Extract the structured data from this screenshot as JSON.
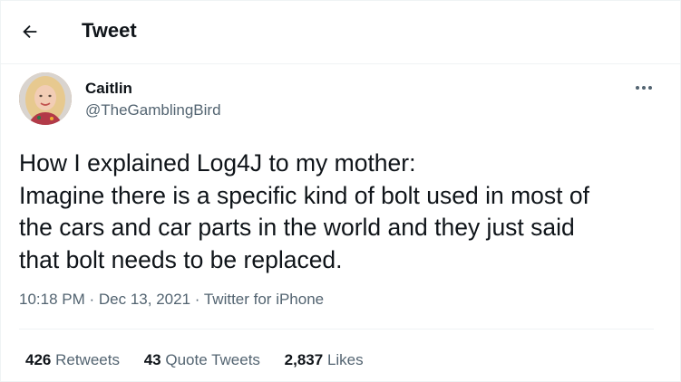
{
  "header": {
    "title": "Tweet",
    "back_icon": "arrow-left-icon"
  },
  "author": {
    "name": "Caitlin",
    "handle": "@TheGamblingBird"
  },
  "tweet": {
    "lines": [
      "How I explained Log4J to my mother:",
      "Imagine there is a specific kind of bolt used in most of",
      "the cars and car parts in the world and they just said",
      "that bolt needs to be replaced."
    ],
    "time": "10:18 PM",
    "date": "Dec 13, 2021",
    "source": "Twitter for iPhone",
    "separator": "·"
  },
  "stats": {
    "retweets_count": "426",
    "retweets_label": "Retweets",
    "quotes_count": "43",
    "quotes_label": "Quote Tweets",
    "likes_count": "2,837",
    "likes_label": "Likes"
  },
  "colors": {
    "text": "#0f1419",
    "secondary": "#536471",
    "border": "#eff3f4"
  }
}
